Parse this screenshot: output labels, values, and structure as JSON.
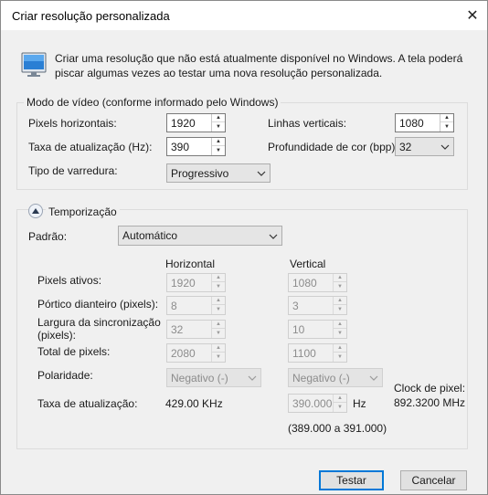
{
  "window": {
    "title": "Criar resolução personalizada"
  },
  "intro": {
    "text": "Criar uma resolução que não está atualmente disponível no Windows. A tela poderá piscar algumas vezes ao testar uma nova resolução personalizada."
  },
  "video_mode": {
    "legend": "Modo de vídeo (conforme informado pelo Windows)",
    "h_pixels_label": "Pixels horizontais:",
    "h_pixels_value": "1920",
    "v_lines_label": "Linhas verticais:",
    "v_lines_value": "1080",
    "refresh_label": "Taxa de atualização (Hz):",
    "refresh_value": "390",
    "color_depth_label": "Profundidade de cor (bpp):",
    "color_depth_value": "32",
    "scan_label": "Tipo de varredura:",
    "scan_value": "Progressivo"
  },
  "timing": {
    "legend": "Temporização",
    "standard_label": "Padrão:",
    "standard_value": "Automático",
    "col_horizontal": "Horizontal",
    "col_vertical": "Vertical",
    "active_pixels_label": "Pixels ativos:",
    "active_h": "1920",
    "active_v": "1080",
    "front_porch_label": "Pórtico dianteiro (pixels):",
    "front_porch_h": "8",
    "front_porch_v": "3",
    "sync_width_label": "Largura da sincronização (pixels):",
    "sync_width_h": "32",
    "sync_width_v": "10",
    "total_pixels_label": "Total de pixels:",
    "total_h": "2080",
    "total_v": "1100",
    "polarity_label": "Polaridade:",
    "polarity_h": "Negativo (-)",
    "polarity_v": "Negativo (-)",
    "refresh_label": "Taxa de atualização:",
    "refresh_h": "429.00 KHz",
    "refresh_v": "390.000",
    "refresh_v_unit": "Hz",
    "refresh_range": "(389.000 a 391.000)",
    "pixel_clock_label": "Clock de pixel:",
    "pixel_clock_value": "892.3200 MHz"
  },
  "buttons": {
    "test": "Testar",
    "cancel": "Cancelar"
  },
  "colors": {
    "accent": "#0078d7",
    "dialog_bg": "#f0f0f0",
    "disabled_text": "#8c8c8c"
  },
  "icons": {
    "monitor": "monitor-icon",
    "close": "close-icon",
    "collapse": "chevron-up-icon",
    "dropdown": "chevron-down-icon"
  }
}
